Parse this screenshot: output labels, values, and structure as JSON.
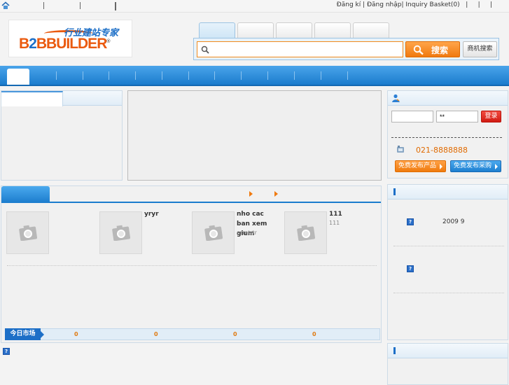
{
  "topbar": {
    "home_icon": "home-icon",
    "register": "Đăng kí",
    "login": "Đăng nhập",
    "inquiry": "Inquiry Basket(0)",
    "sep": "|"
  },
  "logo": {
    "cn_text": "行业建站专家",
    "en_text_b": "B",
    "en_text_2": "2",
    "en_text_rest": "BBUILDER",
    "reg": "®"
  },
  "search": {
    "placeholder": "",
    "button_label": "搜索",
    "biz_label": "商机搜索"
  },
  "member": {
    "username_value": "",
    "password_value": "**",
    "login_label": "登录",
    "phone": "021-8888888",
    "post_product": "免费发布产品",
    "post_purchase": "免费发布采购"
  },
  "products": [
    {
      "name": "",
      "sub": ""
    },
    {
      "name": "yryr",
      "sub": ""
    },
    {
      "name": "nho cac ban xem gium",
      "sub": "erretrtr"
    },
    {
      "name": "111",
      "sub": "111"
    }
  ],
  "market": {
    "label": "今日市场",
    "values": [
      "0",
      "0",
      "0",
      "0"
    ]
  },
  "news": {
    "date": "2009 9"
  },
  "colors": {
    "accent_blue": "#1b7ccd",
    "accent_orange": "#f07a10",
    "login_red": "#e0201a"
  }
}
